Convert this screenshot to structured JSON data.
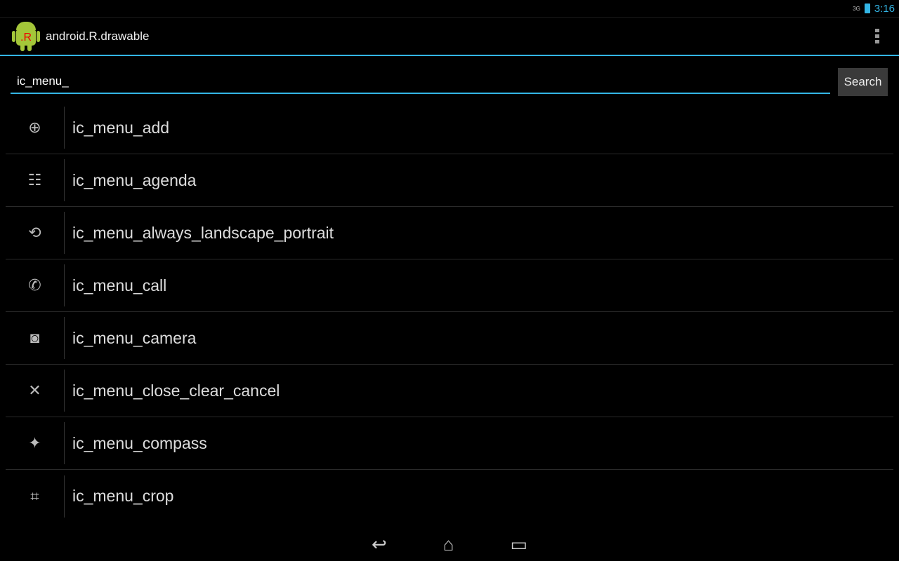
{
  "status": {
    "network": "3G",
    "time": "3:16",
    "battery": "charging",
    "accent": "#33b5e5"
  },
  "actionbar": {
    "title": "android.R.drawable",
    "logo_text": ".R",
    "overflow": "overflow-menu-icon"
  },
  "search": {
    "value": "ic_menu_",
    "button": "Search"
  },
  "items": [
    {
      "label": "ic_menu_add",
      "icon": "⊕"
    },
    {
      "label": "ic_menu_agenda",
      "icon": "☷"
    },
    {
      "label": "ic_menu_always_landscape_portrait",
      "icon": "⟲"
    },
    {
      "label": "ic_menu_call",
      "icon": "✆"
    },
    {
      "label": "ic_menu_camera",
      "icon": "◙"
    },
    {
      "label": "ic_menu_close_clear_cancel",
      "icon": "✕"
    },
    {
      "label": "ic_menu_compass",
      "icon": "✦"
    },
    {
      "label": "ic_menu_crop",
      "icon": "⌗"
    }
  ],
  "nav": {
    "back": "↩",
    "home": "⌂",
    "recents": "▭"
  }
}
